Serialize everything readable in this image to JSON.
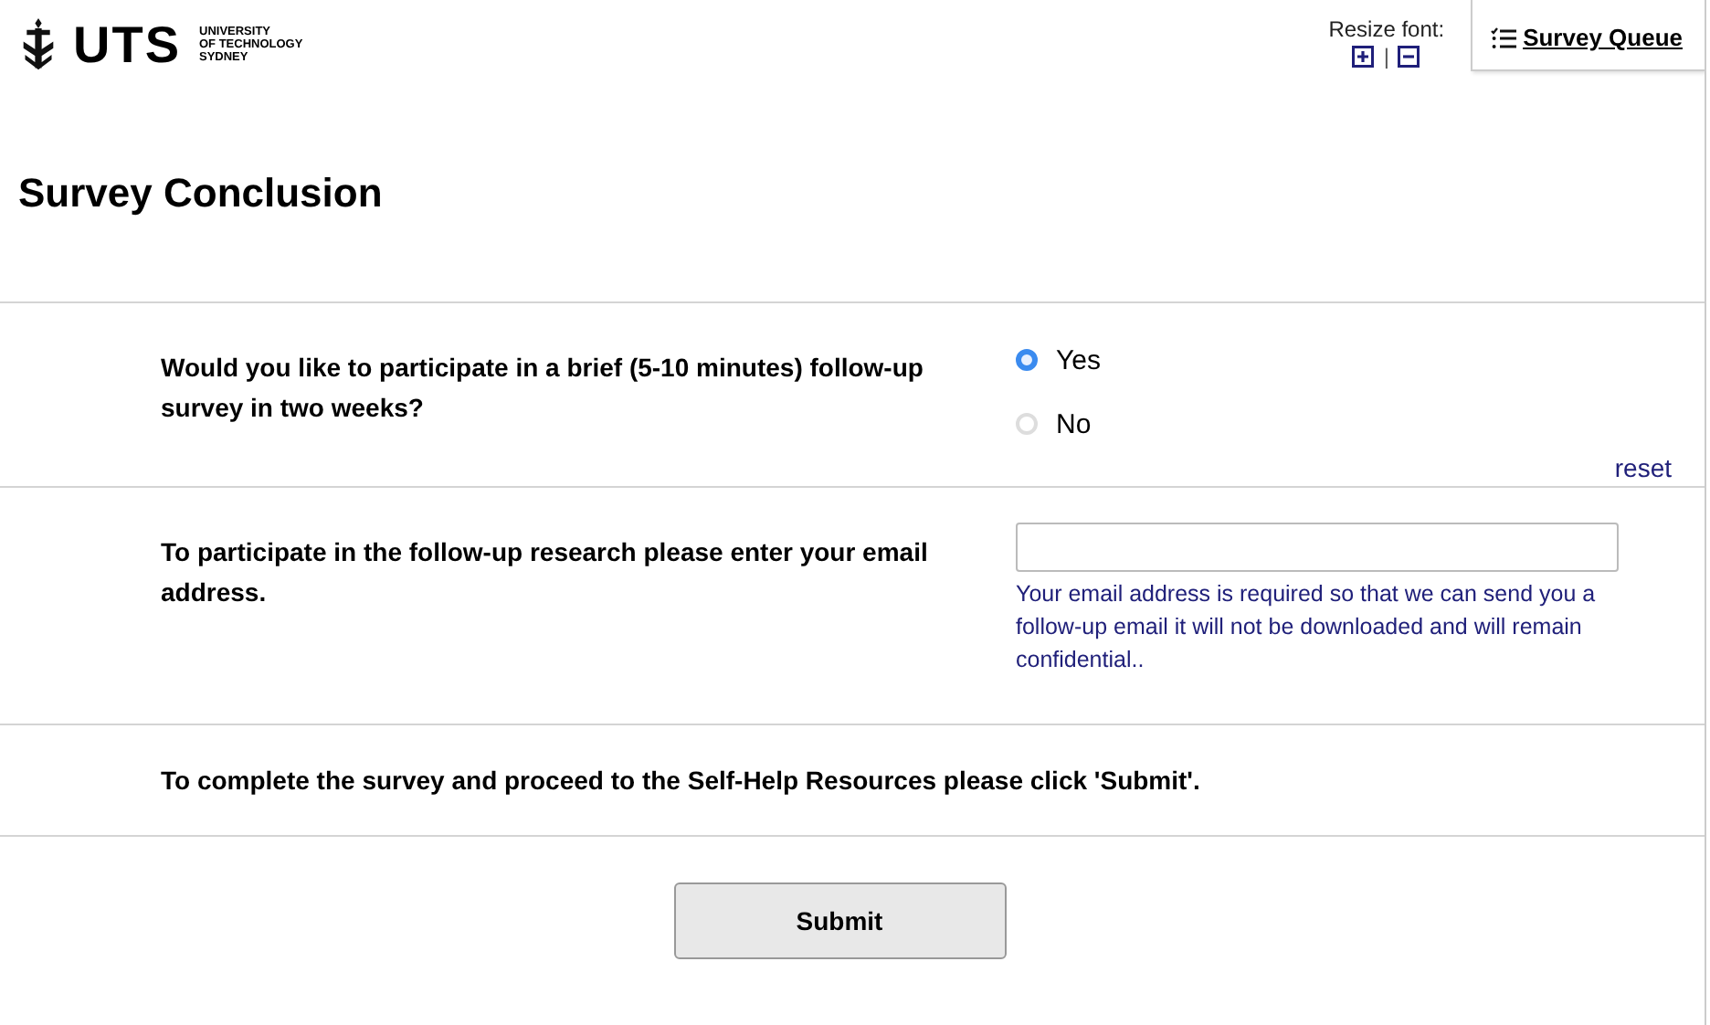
{
  "logo": {
    "wordmark": "UTS",
    "lines": [
      "UNIVERSITY",
      "OF TECHNOLOGY",
      "SYDNEY"
    ]
  },
  "resize_font": {
    "label": "Resize font:",
    "separator": "|"
  },
  "survey_queue": {
    "label": "Survey Queue"
  },
  "title": "Survey Conclusion",
  "questions": [
    {
      "kind": "radio",
      "label": "Would you like to participate in a brief (5-10 minutes) follow-up survey in two weeks?",
      "options": [
        {
          "label": "Yes",
          "selected": true
        },
        {
          "label": "No",
          "selected": false
        }
      ],
      "reset": "reset"
    },
    {
      "kind": "text",
      "label": "To participate in the follow-up research please enter your email address.",
      "note": "Your email address is required so that we can send you a follow-up email it will not be downloaded and will remain confidential.."
    },
    {
      "kind": "descriptive",
      "label": "To complete the survey and proceed to the Self-Help Resources please click 'Submit'."
    }
  ],
  "submit": "Submit"
}
